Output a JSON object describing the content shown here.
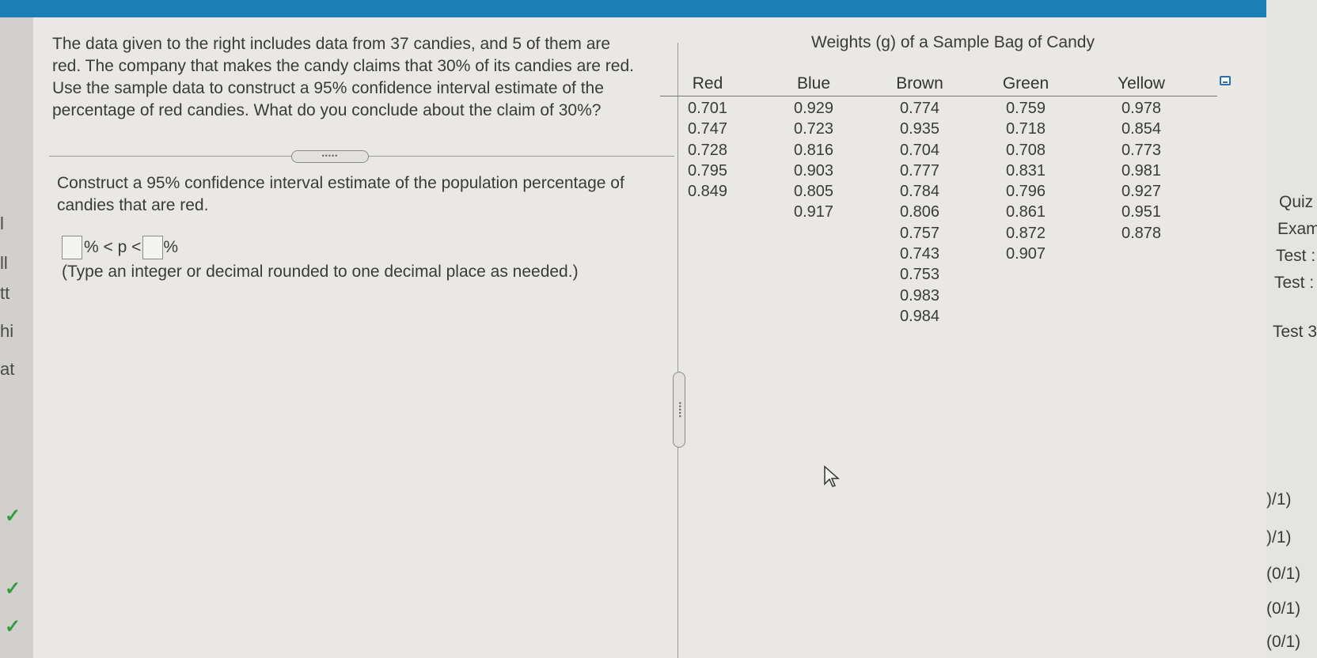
{
  "question": {
    "text": "The data given to the right includes data from 37 candies, and 5 of them are red. The company that makes the candy claims that 30% of its candies are red. Use the sample data to construct a 95% confidence interval estimate of the percentage of red candies. What do you conclude about the claim of 30%?",
    "prompt": "Construct a 95% confidence interval estimate of the population percentage of candies that are red.",
    "inequality_middle": "% < p <",
    "inequality_end": "%",
    "hint": "(Type an integer or decimal rounded to one decimal place as needed.)",
    "handle_dots": "•••••"
  },
  "table": {
    "title": "Weights (g) of a Sample Bag of Candy",
    "columns": [
      {
        "header": "Red",
        "values": [
          "0.701",
          "0.747",
          "0.728",
          "0.795",
          "0.849"
        ]
      },
      {
        "header": "Blue",
        "values": [
          "0.929",
          "0.723",
          "0.816",
          "0.903",
          "0.805",
          "0.917"
        ]
      },
      {
        "header": "Brown",
        "values": [
          "0.774",
          "0.935",
          "0.704",
          "0.777",
          "0.784",
          "0.806",
          "0.757",
          "0.743",
          "0.753",
          "0.983",
          "0.984"
        ]
      },
      {
        "header": "Green",
        "values": [
          "0.759",
          "0.718",
          "0.708",
          "0.831",
          "0.796",
          "0.861",
          "0.872",
          "0.907"
        ]
      },
      {
        "header": "Yellow",
        "values": [
          "0.978",
          "0.854",
          "0.773",
          "0.981",
          "0.927",
          "0.951",
          "0.878"
        ]
      }
    ]
  },
  "left_fragments": [
    "l",
    "ll",
    "tt",
    "hi",
    "at"
  ],
  "right_panel": {
    "items": [
      "Quiz",
      "Exam",
      "Test :",
      "Test :",
      "Test 3",
      ")/1)",
      ")/1)",
      "(0/1)",
      "(0/1)",
      "(0/1)"
    ]
  },
  "colors": {
    "accent": "#1a7fb4",
    "check": "#2e9e3a"
  }
}
